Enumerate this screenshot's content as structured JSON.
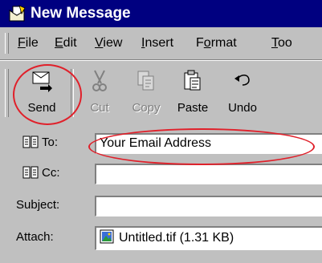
{
  "window": {
    "title": "New Message"
  },
  "menu": {
    "items": [
      {
        "label": "File",
        "access_key": "F",
        "rest": "ile"
      },
      {
        "label": "Edit",
        "access_key": "E",
        "rest": "dit"
      },
      {
        "label": "View",
        "access_key": "V",
        "rest": "iew"
      },
      {
        "label": "Insert",
        "access_key": "I",
        "rest": "nsert"
      },
      {
        "label": "Format",
        "pre": "F",
        "access_key": "o",
        "rest": "rmat"
      },
      {
        "label": "Too",
        "access_key": "T",
        "rest": "oo"
      }
    ]
  },
  "toolbar": {
    "send": {
      "label": "Send",
      "icon": "send-icon",
      "enabled": true
    },
    "cut": {
      "label": "Cut",
      "icon": "scissors-icon",
      "enabled": false
    },
    "copy": {
      "label": "Copy",
      "icon": "copy-icon",
      "enabled": false
    },
    "paste": {
      "label": "Paste",
      "icon": "clipboard-icon",
      "enabled": true
    },
    "undo": {
      "label": "Undo",
      "icon": "undo-icon",
      "enabled": true
    }
  },
  "fields": {
    "to": {
      "label": "To:",
      "value": "Your Email Address"
    },
    "cc": {
      "label": "Cc:",
      "value": ""
    },
    "subject": {
      "label": "Subject:",
      "value": ""
    },
    "attach": {
      "label": "Attach:",
      "value": "Untitled.tif (1.31 KB)"
    }
  },
  "colors": {
    "titlebar": "#000080",
    "highlight": "#e0202a",
    "chrome": "#c0c0c0"
  }
}
